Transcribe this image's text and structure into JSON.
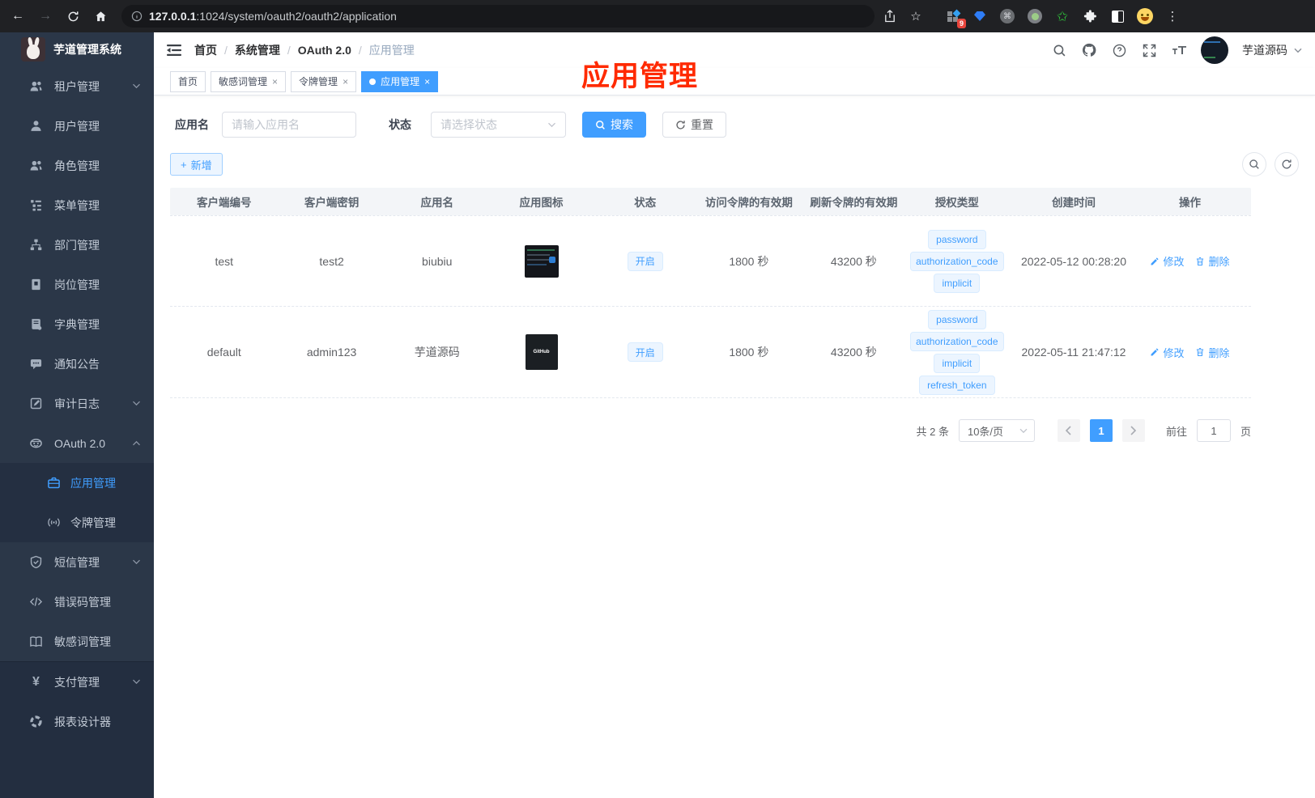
{
  "browser": {
    "url_host": "127.0.0.1",
    "url_path": ":1024/system/oauth2/oauth2/application",
    "extension_badge": "9"
  },
  "sidebar": {
    "title": "芋道管理系统",
    "items": [
      {
        "icon": "tenants-icon",
        "label": "租户管理",
        "chevron": "down",
        "type": "top"
      },
      {
        "icon": "user-icon",
        "label": "用户管理",
        "type": "top"
      },
      {
        "icon": "roles-icon",
        "label": "角色管理",
        "type": "top"
      },
      {
        "icon": "menu-tree-icon",
        "label": "菜单管理",
        "type": "top"
      },
      {
        "icon": "dept-icon",
        "label": "部门管理",
        "type": "top"
      },
      {
        "icon": "post-icon",
        "label": "岗位管理",
        "type": "top"
      },
      {
        "icon": "dict-icon",
        "label": "字典管理",
        "type": "top"
      },
      {
        "icon": "notice-icon",
        "label": "通知公告",
        "type": "top"
      },
      {
        "icon": "audit-icon",
        "label": "审计日志",
        "chevron": "down",
        "type": "top"
      },
      {
        "icon": "oauth-icon",
        "label": "OAuth 2.0",
        "chevron": "up",
        "type": "top"
      },
      {
        "icon": "briefcase-icon",
        "label": "应用管理",
        "type": "sub",
        "active": true
      },
      {
        "icon": "token-icon",
        "label": "令牌管理",
        "type": "sub"
      },
      {
        "icon": "shield-icon",
        "label": "短信管理",
        "chevron": "down",
        "type": "top"
      },
      {
        "icon": "code-icon",
        "label": "错误码管理",
        "type": "top"
      },
      {
        "icon": "book-icon",
        "label": "敏感词管理",
        "type": "top"
      },
      {
        "icon": "yen-icon",
        "label": "支付管理",
        "chevron": "down",
        "type": "top",
        "section": "bottom"
      },
      {
        "icon": "report-icon",
        "label": "报表设计器",
        "type": "top",
        "section": "bottom"
      }
    ]
  },
  "header": {
    "breadcrumb": [
      "首页",
      "系统管理",
      "OAuth 2.0",
      "应用管理"
    ],
    "user_name": "芋道源码"
  },
  "tabs": [
    {
      "label": "首页",
      "closable": false,
      "active": false
    },
    {
      "label": "敏感词管理",
      "closable": true,
      "active": false
    },
    {
      "label": "令牌管理",
      "closable": true,
      "active": false
    },
    {
      "label": "应用管理",
      "closable": true,
      "active": true
    }
  ],
  "annotation": "应用管理",
  "filters": {
    "app_name_label": "应用名",
    "app_name_placeholder": "请输入应用名",
    "status_label": "状态",
    "status_placeholder": "请选择状态",
    "search_label": "搜索",
    "reset_label": "重置"
  },
  "toolbar": {
    "add_label": "新增"
  },
  "table": {
    "columns": [
      "客户端编号",
      "客户端密钥",
      "应用名",
      "应用图标",
      "状态",
      "访问令牌的有效期",
      "刷新令牌的有效期",
      "授权类型",
      "创建时间",
      "操作"
    ],
    "rows": [
      {
        "client_id": "test",
        "secret": "test2",
        "name": "biubiu",
        "icon": "app-screenshot-thumbnail",
        "status": "开启",
        "access": "1800 秒",
        "refresh": "43200 秒",
        "grants": [
          "password",
          "authorization_code",
          "implicit"
        ],
        "created": "2022-05-12 00:28:20"
      },
      {
        "client_id": "default",
        "secret": "admin123",
        "name": "芋道源码",
        "icon": "github-logo-thumbnail",
        "status": "开启",
        "access": "1800 秒",
        "refresh": "43200 秒",
        "grants": [
          "password",
          "authorization_code",
          "implicit",
          "refresh_token"
        ],
        "created": "2022-05-11 21:47:12"
      }
    ],
    "actions": {
      "edit": "修改",
      "delete": "删除"
    }
  },
  "pagination": {
    "total": "共 2 条",
    "page_size": "10条/页",
    "current": "1",
    "goto": "前往",
    "page_unit": "页",
    "goto_value": "1"
  }
}
